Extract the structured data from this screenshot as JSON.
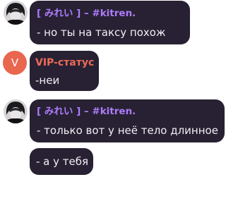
{
  "messages": [
    {
      "author": "[ みれい ] – #kitren.",
      "lines": [
        "- но ты на таксу похож"
      ],
      "avatar_icon": "user-photo-avatar"
    },
    {
      "author": "VIP-статус",
      "lines": [
        "-неи"
      ],
      "avatar_letter": "V",
      "avatar_color": "#e9664f"
    },
    {
      "author": "[ みれい ] – #kitren.",
      "lines": [
        "- только вот у неё тело длинное",
        "- а у тебя"
      ],
      "avatar_icon": "user-photo-avatar"
    }
  ],
  "colors": {
    "bubble": "#272133",
    "username": "#ad7bfa",
    "vip_username": "#ef6a57",
    "text": "#f1eef4"
  }
}
